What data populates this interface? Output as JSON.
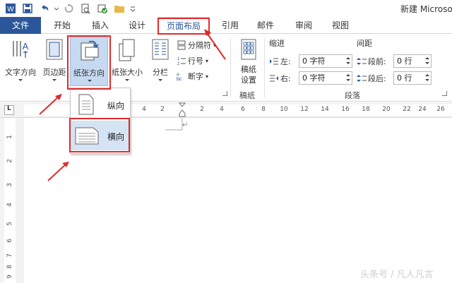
{
  "window": {
    "title": "新建 Microso"
  },
  "qat": {
    "icons": [
      "word-logo-icon",
      "save-icon",
      "undo-icon",
      "redo-icon",
      "print-preview-icon",
      "check-icon",
      "folder-icon",
      "more-icon"
    ]
  },
  "tabs": [
    {
      "label": "文件",
      "active": false
    },
    {
      "label": "开始",
      "active": false
    },
    {
      "label": "插入",
      "active": false
    },
    {
      "label": "设计",
      "active": false
    },
    {
      "label": "页面布局",
      "active": true
    },
    {
      "label": "引用",
      "active": false
    },
    {
      "label": "邮件",
      "active": false
    },
    {
      "label": "审阅",
      "active": false
    },
    {
      "label": "视图",
      "active": false
    }
  ],
  "ribbon": {
    "page_setup": {
      "text_direction": "文字方向",
      "margins": "页边距",
      "orientation": "纸张方向",
      "size": "纸张大小",
      "columns": "分栏",
      "breaks": "分隔符",
      "line_numbers": "行号",
      "hyphenation": "断字"
    },
    "manuscript": {
      "button_line1": "稿纸",
      "button_line2": "设置",
      "group_label": "稿纸"
    },
    "paragraph": {
      "indent_title": "缩进",
      "spacing_title": "间距",
      "indent_left_label": "左:",
      "indent_left_value": "0 字符",
      "indent_right_label": "右:",
      "indent_right_value": "0 字符",
      "spacing_before_label": "段前:",
      "spacing_before_value": "0 行",
      "spacing_after_label": "段后:",
      "spacing_after_value": "0 行",
      "group_label": "段落"
    }
  },
  "orientation_menu": {
    "portrait": "纵向",
    "landscape": "横向"
  },
  "ruler": {
    "corner": "L",
    "numbers": [
      "4",
      "2",
      "2",
      "4",
      "6",
      "8",
      "10",
      "12",
      "14",
      "16",
      "18",
      "20",
      "22",
      "24",
      "26"
    ],
    "vertical_numbers": [
      "1",
      "2",
      "3",
      "4",
      "5",
      "6",
      "7",
      "8",
      "9"
    ]
  },
  "document": {
    "paragraph_mark": "↵"
  },
  "watermark": "头条号 / 凡人凡言",
  "colors": {
    "accent": "#2b579a",
    "highlight": "#e02b2b"
  }
}
